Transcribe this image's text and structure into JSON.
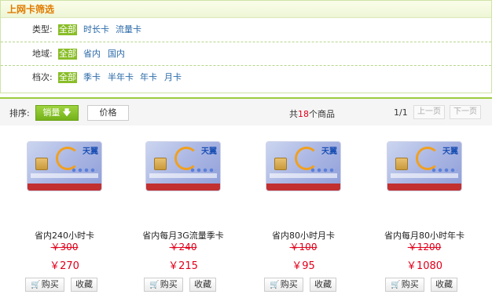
{
  "filter": {
    "title": "上网卡筛选",
    "rows": [
      {
        "label": "类型:",
        "options": [
          "全部",
          "时长卡",
          "流量卡"
        ],
        "selected": 0
      },
      {
        "label": "地域:",
        "options": [
          "全部",
          "省内",
          "国内"
        ],
        "selected": 0
      },
      {
        "label": "档次:",
        "options": [
          "全部",
          "季卡",
          "半年卡",
          "年卡",
          "月卡"
        ],
        "selected": 0
      }
    ]
  },
  "sort": {
    "label": "排序:",
    "sales_label": "销量",
    "price_label": "价格",
    "total_prefix": "共",
    "total_count": "18",
    "total_suffix": "个商品",
    "page_info": "1/1",
    "prev_label": "上一页",
    "next_label": "下一页"
  },
  "products": [
    {
      "name": "省内240小时卡",
      "old_price": "￥300",
      "price": "￥270",
      "buy_label": "购买",
      "fav_label": "收藏",
      "card_brand": "天翼"
    },
    {
      "name": "省内每月3G流量季卡",
      "old_price": "￥240",
      "price": "￥215",
      "buy_label": "购买",
      "fav_label": "收藏",
      "card_brand": "天翼"
    },
    {
      "name": "省内80小时月卡",
      "old_price": "￥100",
      "price": "￥95",
      "buy_label": "购买",
      "fav_label": "收藏",
      "card_brand": "天翼"
    },
    {
      "name": "省内每月80小时年卡",
      "old_price": "￥1200",
      "price": "￥1080",
      "buy_label": "购买",
      "fav_label": "收藏",
      "card_brand": "天翼"
    }
  ],
  "colors": {
    "accent_green": "#89bd27",
    "price_red": "#e0001b",
    "title_orange": "#e07b00",
    "link_blue": "#2a6aa8"
  }
}
